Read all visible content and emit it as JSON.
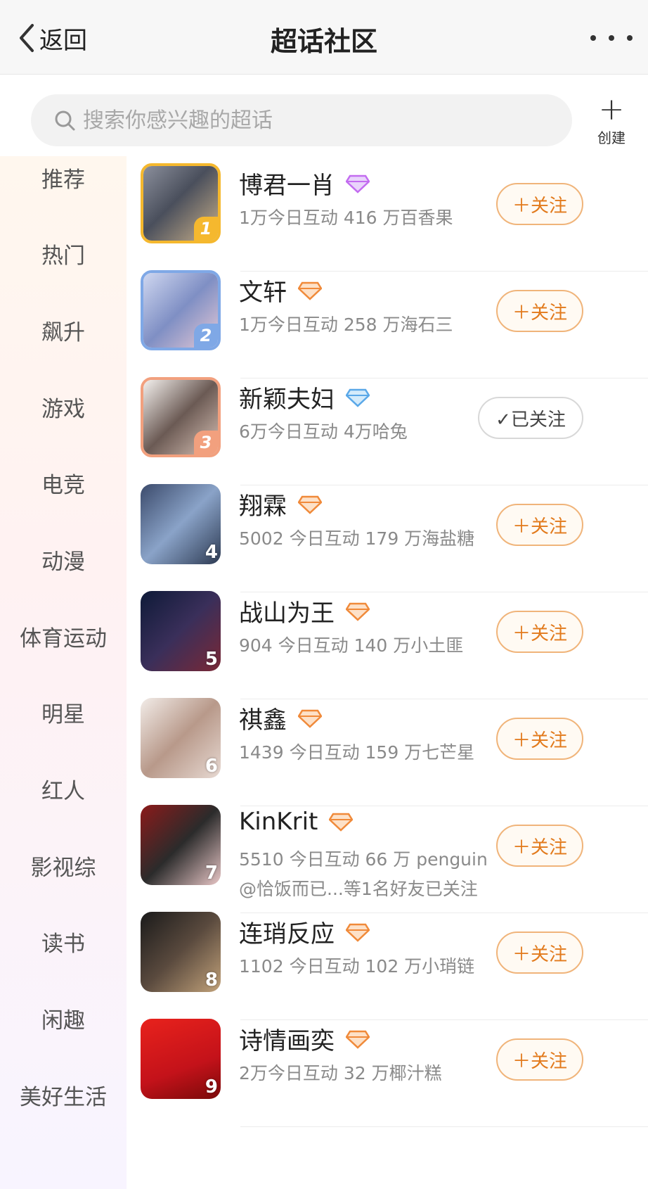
{
  "header": {
    "back_label": "返回",
    "title": "超话社区",
    "more_icon": "more-dots-icon"
  },
  "search": {
    "placeholder": "搜索你感兴趣的超话",
    "create_label": "创建"
  },
  "sidebar": {
    "items": [
      {
        "label": "推荐"
      },
      {
        "label": "热门"
      },
      {
        "label": "飙升"
      },
      {
        "label": "游戏"
      },
      {
        "label": "电竞"
      },
      {
        "label": "动漫"
      },
      {
        "label": "体育运动"
      },
      {
        "label": "明星"
      },
      {
        "label": "红人"
      },
      {
        "label": "影视综"
      },
      {
        "label": "读书"
      },
      {
        "label": "闲趣"
      },
      {
        "label": "美好生活"
      }
    ]
  },
  "topics": [
    {
      "rank": "1",
      "name": "博君一肖",
      "gem": "purple",
      "stats": "1万今日互动 416 万百香果",
      "friends": "",
      "button": "＋关注",
      "followed": false
    },
    {
      "rank": "2",
      "name": "文轩",
      "gem": "orange",
      "stats": "1万今日互动 258 万海石三",
      "friends": "",
      "button": "＋关注",
      "followed": false
    },
    {
      "rank": "3",
      "name": "新颖夫妇",
      "gem": "blue",
      "stats": "6万今日互动 4万哈兔",
      "friends": "",
      "button": "✓已关注",
      "followed": true
    },
    {
      "rank": "4",
      "name": "翔霖",
      "gem": "orange",
      "stats": "5002 今日互动 179 万海盐糖",
      "friends": "",
      "button": "＋关注",
      "followed": false
    },
    {
      "rank": "5",
      "name": "战山为王",
      "gem": "orange",
      "stats": "904 今日互动 140 万小土匪",
      "friends": "",
      "button": "＋关注",
      "followed": false
    },
    {
      "rank": "6",
      "name": "祺鑫",
      "gem": "orange",
      "stats": "1439 今日互动 159 万七芒星",
      "friends": "",
      "button": "＋关注",
      "followed": false
    },
    {
      "rank": "7",
      "name": "KinKrit",
      "gem": "orange",
      "stats": "5510 今日互动 66 万 penguin",
      "friends": "@恰饭而已...等1名好友已关注",
      "button": "＋关注",
      "followed": false
    },
    {
      "rank": "8",
      "name": "连琑反应",
      "gem": "orange",
      "stats": "1102 今日互动 102 万小琑链",
      "friends": "",
      "button": "＋关注",
      "followed": false
    },
    {
      "rank": "9",
      "name": "诗情画奕",
      "gem": "orange",
      "stats": "2万今日互动 32 万椰汁糕",
      "friends": "",
      "button": "＋关注",
      "followed": false
    }
  ],
  "colors": {
    "accent_orange": "#e27a1c",
    "gem_purple": "#c36cf0",
    "gem_orange": "#f08a3a",
    "gem_blue": "#5aa8e8"
  }
}
